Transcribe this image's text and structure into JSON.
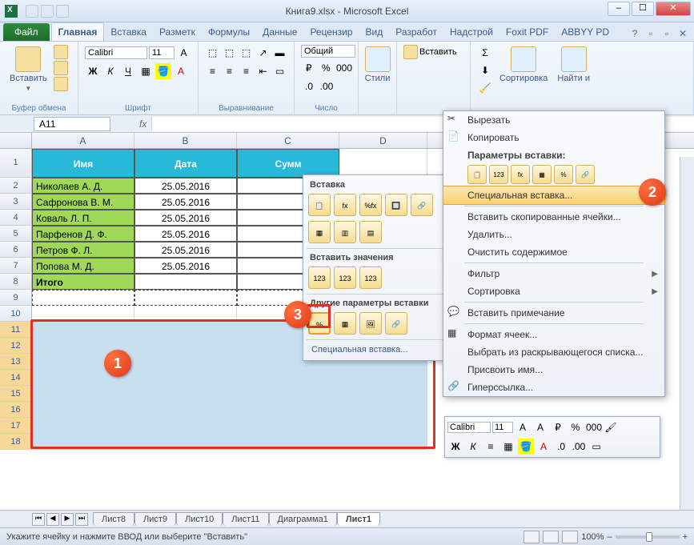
{
  "title": "Книга9.xlsx - Microsoft Excel",
  "tabs": {
    "file": "Файл",
    "list": [
      "Главная",
      "Вставка",
      "Разметк",
      "Формулы",
      "Данные",
      "Рецензир",
      "Вид",
      "Разработ",
      "Надстрой",
      "Foxit PDF",
      "ABBYY PD"
    ],
    "active": 0
  },
  "ribbon": {
    "clipboard": {
      "label": "Буфер обмена",
      "paste": "Вставить"
    },
    "font": {
      "label": "Шрифт",
      "name": "Calibri",
      "size": "11"
    },
    "align": {
      "label": "Выравнивание"
    },
    "number": {
      "label": "Число",
      "format": "Общий"
    },
    "styles": {
      "label": "Стили"
    },
    "cells": {
      "insert": "Вставить"
    },
    "editing": {
      "sort": "Сортировка",
      "find": "Найти и"
    }
  },
  "name_box": "A11",
  "columns": [
    "A",
    "B",
    "C",
    "D"
  ],
  "headers": {
    "name": "Имя",
    "date": "Дата",
    "sum": "Сумм"
  },
  "rows": [
    {
      "name": "Николаев А. Д.",
      "date": "25.05.2016"
    },
    {
      "name": "Сафронова В. М.",
      "date": "25.05.2016"
    },
    {
      "name": "Коваль Л. П.",
      "date": "25.05.2016"
    },
    {
      "name": "Парфенов Д. Ф.",
      "date": "25.05.2016"
    },
    {
      "name": "Петров Ф. Л.",
      "date": "25.05.2016"
    },
    {
      "name": "Попова М. Д.",
      "date": "25.05.2016"
    }
  ],
  "total": "Итого",
  "paste_gallery": {
    "h1": "Вставка",
    "h2": "Вставить значения",
    "h3": "Другие параметры вставки",
    "special": "Специальная вставка...",
    "icons1": [
      "📋",
      "fx",
      "%fx",
      "🔲",
      "🔗"
    ],
    "icons2": [
      "▦",
      "▥",
      "▤"
    ],
    "icons3": [
      "123",
      "123",
      "123"
    ],
    "icons4": [
      "%",
      "▦",
      "🖼",
      "🔗"
    ]
  },
  "context": {
    "cut": "Вырезать",
    "copy": "Копировать",
    "paste_opts": "Параметры вставки:",
    "paste_icons": [
      "📋",
      "123",
      "fx",
      "▦",
      "%",
      "🔗"
    ],
    "special": "Специальная вставка...",
    "insert_copied": "Вставить скопированные ячейки...",
    "delete": "Удалить...",
    "clear": "Очистить содержимое",
    "filter": "Фильтр",
    "sort": "Сортировка",
    "comment": "Вставить примечание",
    "format": "Формат ячеек...",
    "dropdown": "Выбрать из раскрывающегося списка...",
    "name": "Присвоить имя...",
    "link": "Гиперссылка..."
  },
  "mini": {
    "font": "Calibri",
    "size": "11"
  },
  "sheets": [
    "Лист8",
    "Лист9",
    "Лист10",
    "Лист11",
    "Диаграмма1",
    "Лист1"
  ],
  "active_sheet": 5,
  "status": "Укажите ячейку и нажмите ВВОД или выберите \"Вставить\"",
  "zoom": "100%",
  "callouts": {
    "1": "1",
    "2": "2",
    "3": "3"
  }
}
